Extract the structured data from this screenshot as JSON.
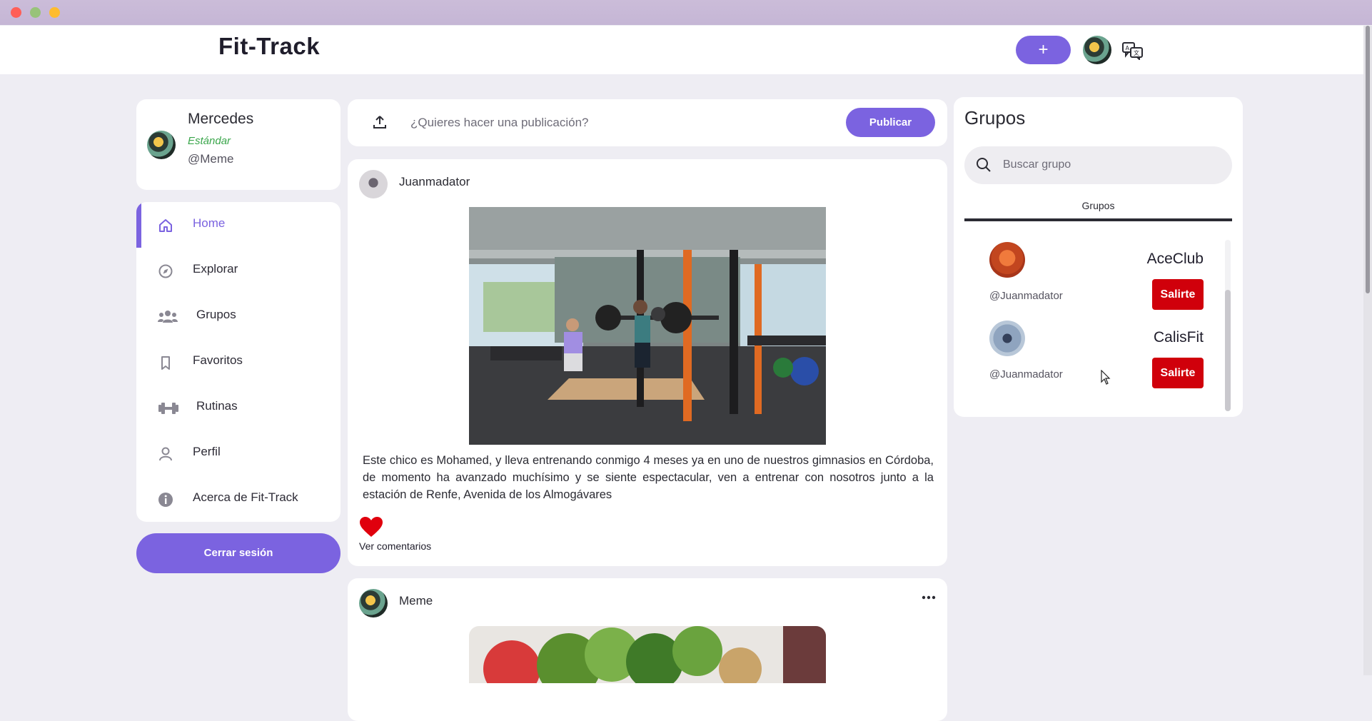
{
  "app": {
    "title": "Fit-Track",
    "accent": "#7b63e0"
  },
  "topbar": {
    "add_label": "+",
    "avatar_alt": "user avatar",
    "translate_icon": "translate-icon"
  },
  "profile": {
    "name": "Mercedes",
    "tier": "Estándar",
    "handle": "@Meme"
  },
  "nav": {
    "items": [
      {
        "label": "Home",
        "icon": "home-icon",
        "active": true
      },
      {
        "label": "Explorar",
        "icon": "compass-icon"
      },
      {
        "label": "Grupos",
        "icon": "users-icon"
      },
      {
        "label": "Favoritos",
        "icon": "bookmark-icon"
      },
      {
        "label": "Rutinas",
        "icon": "dumbbell-icon"
      },
      {
        "label": "Perfil",
        "icon": "user-icon"
      },
      {
        "label": "Acerca de Fit-Track",
        "icon": "info-icon"
      }
    ],
    "logout_label": "Cerrar sesión"
  },
  "composer": {
    "placeholder": "¿Quieres hacer una publicación?",
    "publish_label": "Publicar"
  },
  "posts": [
    {
      "author": "Juanmadator",
      "text": "Este chico es Mohamed, y lleva entrenando conmigo 4 meses ya en uno de nuestros gimnasios en Córdoba, de momento ha avanzado muchísimo y se siente espectacular, ven a entrenar con nosotros junto a la estación de Renfe, Avenida de los Almogávares",
      "liked": true,
      "comments_label": "Ver comentarios"
    },
    {
      "author": "Meme"
    }
  ],
  "groups": {
    "title": "Grupos",
    "search_placeholder": "Buscar grupo",
    "tab_label": "Grupos",
    "items": [
      {
        "name": "AceClub",
        "owner": "@Juanmadator",
        "leave_label": "Salirte"
      },
      {
        "name": "CalisFit",
        "owner": "@Juanmadator",
        "leave_label": "Salirte"
      }
    ]
  },
  "colors": {
    "leave_button": "#d0000b",
    "tier": "#3aa64b",
    "heart": "#e0000d"
  }
}
